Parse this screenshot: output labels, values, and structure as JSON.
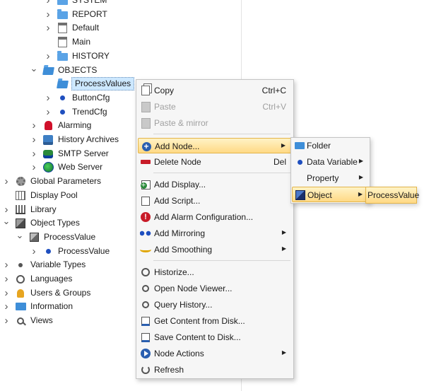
{
  "tree": [
    {
      "label": "SYSTEM",
      "indent": 3,
      "chevron": "right",
      "icon": "folder-icon"
    },
    {
      "label": "REPORT",
      "indent": 3,
      "chevron": "right",
      "icon": "folder-icon"
    },
    {
      "label": "Default",
      "indent": 3,
      "chevron": "right",
      "icon": "page-icon"
    },
    {
      "label": "Main",
      "indent": 3,
      "chevron": "none",
      "icon": "page-icon"
    },
    {
      "label": "HISTORY",
      "indent": 3,
      "chevron": "right",
      "icon": "folder-icon"
    },
    {
      "label": "OBJECTS",
      "indent": 2,
      "chevron": "down",
      "icon": "folder-open-icon"
    },
    {
      "label": "ProcessValues",
      "indent": 3,
      "chevron": "none",
      "icon": "folder-open-icon",
      "selected": true
    },
    {
      "label": "ButtonCfg",
      "indent": 3,
      "chevron": "right",
      "icon": "object-dot-icon"
    },
    {
      "label": "TrendCfg",
      "indent": 3,
      "chevron": "right",
      "icon": "object-dot-icon"
    },
    {
      "label": "Alarming",
      "indent": 2,
      "chevron": "right",
      "icon": "alarm-bell-icon"
    },
    {
      "label": "History Archives",
      "indent": 2,
      "chevron": "right",
      "icon": "history-archive-icon"
    },
    {
      "label": "SMTP Server",
      "indent": 2,
      "chevron": "right",
      "icon": "smtp-server-icon"
    },
    {
      "label": "Web Server",
      "indent": 2,
      "chevron": "right",
      "icon": "web-server-icon"
    },
    {
      "label": "Global Parameters",
      "indent": 0,
      "chevron": "right",
      "icon": "gear-icon"
    },
    {
      "label": "Display Pool",
      "indent": 0,
      "chevron": "none",
      "icon": "display-pool-icon"
    },
    {
      "label": "Library",
      "indent": 0,
      "chevron": "right",
      "icon": "library-icon"
    },
    {
      "label": "Object Types",
      "indent": 0,
      "chevron": "down",
      "icon": "cube-icon"
    },
    {
      "label": "ProcessValue",
      "indent": 1,
      "chevron": "down",
      "icon": "cube-small-icon"
    },
    {
      "label": "ProcessValue",
      "indent": 2,
      "chevron": "right",
      "icon": "object-dot-icon"
    },
    {
      "label": "Variable Types",
      "indent": 0,
      "chevron": "right",
      "icon": "variable-type-icon"
    },
    {
      "label": "Languages",
      "indent": 0,
      "chevron": "right",
      "icon": "language-icon"
    },
    {
      "label": "Users & Groups",
      "indent": 0,
      "chevron": "right",
      "icon": "users-icon"
    },
    {
      "label": "Information",
      "indent": 0,
      "chevron": "right",
      "icon": "information-folder-icon"
    },
    {
      "label": "Views",
      "indent": 0,
      "chevron": "right",
      "icon": "views-icon"
    }
  ],
  "menu": {
    "copy": "Copy",
    "copy_shortcut": "Ctrl+C",
    "paste": "Paste",
    "paste_shortcut": "Ctrl+V",
    "paste_mirror": "Paste & mirror",
    "add_node": "Add Node...",
    "delete_node": "Delete Node",
    "delete_shortcut": "Del",
    "add_display": "Add Display...",
    "add_script": "Add Script...",
    "add_alarm": "Add Alarm Configuration...",
    "add_mirroring": "Add Mirroring",
    "add_smoothing": "Add Smoothing",
    "historize": "Historize...",
    "open_node_viewer": "Open Node Viewer...",
    "query_history": "Query History...",
    "get_content": "Get Content from Disk...",
    "save_content": "Save Content to Disk...",
    "node_actions": "Node Actions",
    "refresh": "Refresh"
  },
  "submenu": {
    "folder": "Folder",
    "data_variable": "Data Variable",
    "property": "Property",
    "object": "Object",
    "object_child": "ProcessValue"
  }
}
